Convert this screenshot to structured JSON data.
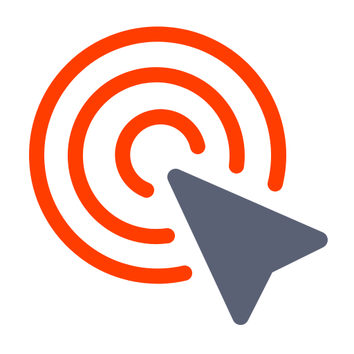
{
  "icon": {
    "name": "click-target-icon",
    "colors": {
      "rings": "#FF3D00",
      "cursor": "#5B6175",
      "background": "#FFFFFF"
    }
  }
}
